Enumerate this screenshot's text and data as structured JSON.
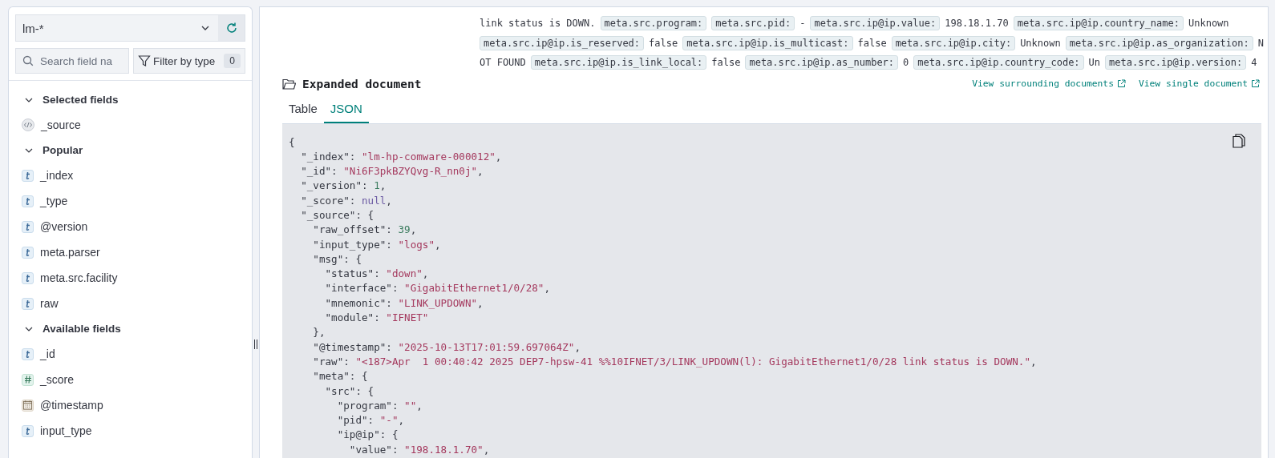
{
  "sidebar": {
    "data_view": "lm-*",
    "search": {
      "placeholder": "Search field na"
    },
    "filter": {
      "label": "Filter by type",
      "count": "0"
    },
    "sections": [
      {
        "title": "Selected fields",
        "expanded": true,
        "fields": [
          {
            "name": "_source",
            "kind": "source"
          }
        ]
      },
      {
        "title": "Popular",
        "expanded": true,
        "fields": [
          {
            "name": "_index",
            "kind": "string"
          },
          {
            "name": "_type",
            "kind": "string"
          },
          {
            "name": "@version",
            "kind": "string"
          },
          {
            "name": "meta.parser",
            "kind": "string"
          },
          {
            "name": "meta.src.facility",
            "kind": "string"
          },
          {
            "name": "raw",
            "kind": "string"
          }
        ]
      },
      {
        "title": "Available fields",
        "expanded": true,
        "fields": [
          {
            "name": "_id",
            "kind": "string"
          },
          {
            "name": "_score",
            "kind": "number"
          },
          {
            "name": "@timestamp",
            "kind": "date"
          },
          {
            "name": "input_type",
            "kind": "string"
          }
        ]
      }
    ]
  },
  "summary": [
    [
      {
        "kind": "text",
        "text": "link status is DOWN."
      },
      {
        "kind": "field",
        "text": "meta.src.program:"
      },
      {
        "kind": "field",
        "text": "meta.src.pid:"
      },
      {
        "kind": "text",
        "text": "-"
      },
      {
        "kind": "field",
        "text": "meta.src.ip@ip.value:"
      },
      {
        "kind": "text",
        "text": "198.18.1.70"
      },
      {
        "kind": "field",
        "text": "meta.src.ip@ip.country_name:"
      },
      {
        "kind": "text",
        "text": "Unknown"
      }
    ],
    [
      {
        "kind": "field",
        "text": "meta.src.ip@ip.is_reserved:"
      },
      {
        "kind": "text",
        "text": "false"
      },
      {
        "kind": "field",
        "text": "meta.src.ip@ip.is_multicast:"
      },
      {
        "kind": "text",
        "text": "false"
      },
      {
        "kind": "field",
        "text": "meta.src.ip@ip.city:"
      },
      {
        "kind": "text",
        "text": "Unknown"
      },
      {
        "kind": "field",
        "text": "meta.src.ip@ip.as_organization:"
      },
      {
        "kind": "text",
        "text": "N"
      }
    ],
    [
      {
        "kind": "text",
        "text": "OT FOUND"
      },
      {
        "kind": "field",
        "text": "meta.src.ip@ip.is_link_local:"
      },
      {
        "kind": "text",
        "text": "false"
      },
      {
        "kind": "field",
        "text": "meta.src.ip@ip.as_number:"
      },
      {
        "kind": "text",
        "text": "0"
      },
      {
        "kind": "field",
        "text": "meta.src.ip@ip.country_code:"
      },
      {
        "kind": "text",
        "text": "Un"
      },
      {
        "kind": "field",
        "text": "meta.src.ip@ip.version:"
      },
      {
        "kind": "text",
        "text": "4"
      }
    ]
  ],
  "document": {
    "title": "Expanded document",
    "links": [
      "View surrounding documents",
      "View single document"
    ],
    "tabs": [
      {
        "label": "Table",
        "selected": false
      },
      {
        "label": "JSON",
        "selected": true
      }
    ],
    "code": [
      [
        {
          "kind": "punct",
          "text": "{"
        }
      ],
      [
        {
          "kind": "punct",
          "text": "  \"_index\": "
        },
        {
          "kind": "string",
          "text": "\"lm-hp-comware-000012\""
        },
        {
          "kind": "punct",
          "text": ","
        }
      ],
      [
        {
          "kind": "punct",
          "text": "  \"_id\": "
        },
        {
          "kind": "string",
          "text": "\"Ni6F3pkBZYQvg-R_nn0j\""
        },
        {
          "kind": "punct",
          "text": ","
        }
      ],
      [
        {
          "kind": "punct",
          "text": "  \"_version\": "
        },
        {
          "kind": "number",
          "text": "1"
        },
        {
          "kind": "punct",
          "text": ","
        }
      ],
      [
        {
          "kind": "punct",
          "text": "  \"_score\": "
        },
        {
          "kind": "null",
          "text": "null"
        },
        {
          "kind": "punct",
          "text": ","
        }
      ],
      [
        {
          "kind": "punct",
          "text": "  \"_source\": {"
        }
      ],
      [
        {
          "kind": "punct",
          "text": "    \"raw_offset\": "
        },
        {
          "kind": "number",
          "text": "39"
        },
        {
          "kind": "punct",
          "text": ","
        }
      ],
      [
        {
          "kind": "punct",
          "text": "    \"input_type\": "
        },
        {
          "kind": "string",
          "text": "\"logs\""
        },
        {
          "kind": "punct",
          "text": ","
        }
      ],
      [
        {
          "kind": "punct",
          "text": "    \"msg\": {"
        }
      ],
      [
        {
          "kind": "punct",
          "text": "      \"status\": "
        },
        {
          "kind": "string",
          "text": "\"down\""
        },
        {
          "kind": "punct",
          "text": ","
        }
      ],
      [
        {
          "kind": "punct",
          "text": "      \"interface\": "
        },
        {
          "kind": "string",
          "text": "\"GigabitEthernet1/0/28\""
        },
        {
          "kind": "punct",
          "text": ","
        }
      ],
      [
        {
          "kind": "punct",
          "text": "      \"mnemonic\": "
        },
        {
          "kind": "string",
          "text": "\"LINK_UPDOWN\""
        },
        {
          "kind": "punct",
          "text": ","
        }
      ],
      [
        {
          "kind": "punct",
          "text": "      \"module\": "
        },
        {
          "kind": "string",
          "text": "\"IFNET\""
        }
      ],
      [
        {
          "kind": "punct",
          "text": "    },"
        }
      ],
      [
        {
          "kind": "punct",
          "text": "    \"@timestamp\": "
        },
        {
          "kind": "string",
          "text": "\"2025-10-13T17:01:59.697064Z\""
        },
        {
          "kind": "punct",
          "text": ","
        }
      ],
      [
        {
          "kind": "punct",
          "text": "    \"raw\": "
        },
        {
          "kind": "string",
          "text": "\"<187>Apr  1 00:40:42 2025 DEP7-hpsw-41 %%10IFNET/3/LINK_UPDOWN(l): GigabitEthernet1/0/28 link status is DOWN.\""
        },
        {
          "kind": "punct",
          "text": ","
        }
      ],
      [
        {
          "kind": "punct",
          "text": "    \"meta\": {"
        }
      ],
      [
        {
          "kind": "punct",
          "text": "      \"src\": {"
        }
      ],
      [
        {
          "kind": "punct",
          "text": "        \"program\": "
        },
        {
          "kind": "string",
          "text": "\"\""
        },
        {
          "kind": "punct",
          "text": ","
        }
      ],
      [
        {
          "kind": "punct",
          "text": "        \"pid\": "
        },
        {
          "kind": "string",
          "text": "\"-\""
        },
        {
          "kind": "punct",
          "text": ","
        }
      ],
      [
        {
          "kind": "punct",
          "text": "        \"ip@ip\": {"
        }
      ],
      [
        {
          "kind": "punct",
          "text": "          \"value\": "
        },
        {
          "kind": "string",
          "text": "\"198.18.1.70\""
        },
        {
          "kind": "punct",
          "text": ","
        }
      ]
    ]
  }
}
